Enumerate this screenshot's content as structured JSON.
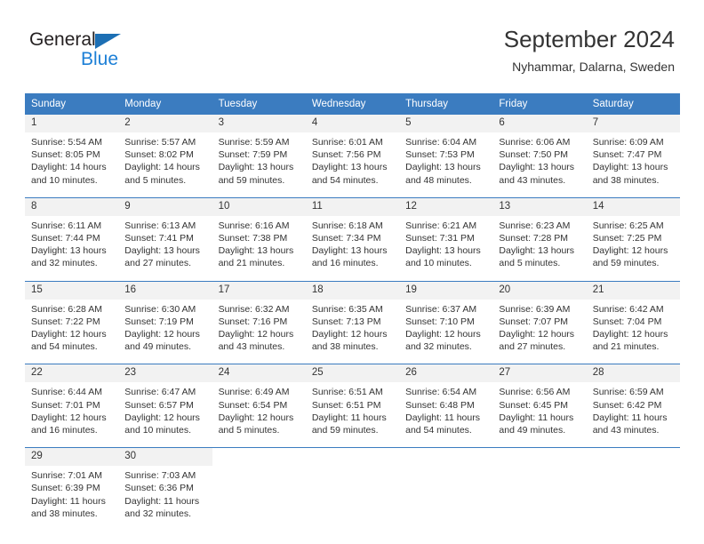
{
  "brand": {
    "name_part1": "General",
    "name_part2": "Blue",
    "triangle_icon": "blue-triangle-icon"
  },
  "header": {
    "title": "September 2024",
    "subtitle": "Nyhammar, Dalarna, Sweden"
  },
  "colors": {
    "header_blue": "#3b7cc0",
    "day_number_bg": "#f2f2f2",
    "brand_blue": "#1c7fd6",
    "text": "#333333"
  },
  "weekdays": [
    "Sunday",
    "Monday",
    "Tuesday",
    "Wednesday",
    "Thursday",
    "Friday",
    "Saturday"
  ],
  "labels": {
    "sunrise_prefix": "Sunrise:",
    "sunset_prefix": "Sunset:",
    "daylight_prefix": "Daylight:"
  },
  "weeks": [
    [
      {
        "day": "1",
        "sunrise": "Sunrise: 5:54 AM",
        "sunset": "Sunset: 8:05 PM",
        "daylight": "Daylight: 14 hours and 10 minutes."
      },
      {
        "day": "2",
        "sunrise": "Sunrise: 5:57 AM",
        "sunset": "Sunset: 8:02 PM",
        "daylight": "Daylight: 14 hours and 5 minutes."
      },
      {
        "day": "3",
        "sunrise": "Sunrise: 5:59 AM",
        "sunset": "Sunset: 7:59 PM",
        "daylight": "Daylight: 13 hours and 59 minutes."
      },
      {
        "day": "4",
        "sunrise": "Sunrise: 6:01 AM",
        "sunset": "Sunset: 7:56 PM",
        "daylight": "Daylight: 13 hours and 54 minutes."
      },
      {
        "day": "5",
        "sunrise": "Sunrise: 6:04 AM",
        "sunset": "Sunset: 7:53 PM",
        "daylight": "Daylight: 13 hours and 48 minutes."
      },
      {
        "day": "6",
        "sunrise": "Sunrise: 6:06 AM",
        "sunset": "Sunset: 7:50 PM",
        "daylight": "Daylight: 13 hours and 43 minutes."
      },
      {
        "day": "7",
        "sunrise": "Sunrise: 6:09 AM",
        "sunset": "Sunset: 7:47 PM",
        "daylight": "Daylight: 13 hours and 38 minutes."
      }
    ],
    [
      {
        "day": "8",
        "sunrise": "Sunrise: 6:11 AM",
        "sunset": "Sunset: 7:44 PM",
        "daylight": "Daylight: 13 hours and 32 minutes."
      },
      {
        "day": "9",
        "sunrise": "Sunrise: 6:13 AM",
        "sunset": "Sunset: 7:41 PM",
        "daylight": "Daylight: 13 hours and 27 minutes."
      },
      {
        "day": "10",
        "sunrise": "Sunrise: 6:16 AM",
        "sunset": "Sunset: 7:38 PM",
        "daylight": "Daylight: 13 hours and 21 minutes."
      },
      {
        "day": "11",
        "sunrise": "Sunrise: 6:18 AM",
        "sunset": "Sunset: 7:34 PM",
        "daylight": "Daylight: 13 hours and 16 minutes."
      },
      {
        "day": "12",
        "sunrise": "Sunrise: 6:21 AM",
        "sunset": "Sunset: 7:31 PM",
        "daylight": "Daylight: 13 hours and 10 minutes."
      },
      {
        "day": "13",
        "sunrise": "Sunrise: 6:23 AM",
        "sunset": "Sunset: 7:28 PM",
        "daylight": "Daylight: 13 hours and 5 minutes."
      },
      {
        "day": "14",
        "sunrise": "Sunrise: 6:25 AM",
        "sunset": "Sunset: 7:25 PM",
        "daylight": "Daylight: 12 hours and 59 minutes."
      }
    ],
    [
      {
        "day": "15",
        "sunrise": "Sunrise: 6:28 AM",
        "sunset": "Sunset: 7:22 PM",
        "daylight": "Daylight: 12 hours and 54 minutes."
      },
      {
        "day": "16",
        "sunrise": "Sunrise: 6:30 AM",
        "sunset": "Sunset: 7:19 PM",
        "daylight": "Daylight: 12 hours and 49 minutes."
      },
      {
        "day": "17",
        "sunrise": "Sunrise: 6:32 AM",
        "sunset": "Sunset: 7:16 PM",
        "daylight": "Daylight: 12 hours and 43 minutes."
      },
      {
        "day": "18",
        "sunrise": "Sunrise: 6:35 AM",
        "sunset": "Sunset: 7:13 PM",
        "daylight": "Daylight: 12 hours and 38 minutes."
      },
      {
        "day": "19",
        "sunrise": "Sunrise: 6:37 AM",
        "sunset": "Sunset: 7:10 PM",
        "daylight": "Daylight: 12 hours and 32 minutes."
      },
      {
        "day": "20",
        "sunrise": "Sunrise: 6:39 AM",
        "sunset": "Sunset: 7:07 PM",
        "daylight": "Daylight: 12 hours and 27 minutes."
      },
      {
        "day": "21",
        "sunrise": "Sunrise: 6:42 AM",
        "sunset": "Sunset: 7:04 PM",
        "daylight": "Daylight: 12 hours and 21 minutes."
      }
    ],
    [
      {
        "day": "22",
        "sunrise": "Sunrise: 6:44 AM",
        "sunset": "Sunset: 7:01 PM",
        "daylight": "Daylight: 12 hours and 16 minutes."
      },
      {
        "day": "23",
        "sunrise": "Sunrise: 6:47 AM",
        "sunset": "Sunset: 6:57 PM",
        "daylight": "Daylight: 12 hours and 10 minutes."
      },
      {
        "day": "24",
        "sunrise": "Sunrise: 6:49 AM",
        "sunset": "Sunset: 6:54 PM",
        "daylight": "Daylight: 12 hours and 5 minutes."
      },
      {
        "day": "25",
        "sunrise": "Sunrise: 6:51 AM",
        "sunset": "Sunset: 6:51 PM",
        "daylight": "Daylight: 11 hours and 59 minutes."
      },
      {
        "day": "26",
        "sunrise": "Sunrise: 6:54 AM",
        "sunset": "Sunset: 6:48 PM",
        "daylight": "Daylight: 11 hours and 54 minutes."
      },
      {
        "day": "27",
        "sunrise": "Sunrise: 6:56 AM",
        "sunset": "Sunset: 6:45 PM",
        "daylight": "Daylight: 11 hours and 49 minutes."
      },
      {
        "day": "28",
        "sunrise": "Sunrise: 6:59 AM",
        "sunset": "Sunset: 6:42 PM",
        "daylight": "Daylight: 11 hours and 43 minutes."
      }
    ],
    [
      {
        "day": "29",
        "sunrise": "Sunrise: 7:01 AM",
        "sunset": "Sunset: 6:39 PM",
        "daylight": "Daylight: 11 hours and 38 minutes."
      },
      {
        "day": "30",
        "sunrise": "Sunrise: 7:03 AM",
        "sunset": "Sunset: 6:36 PM",
        "daylight": "Daylight: 11 hours and 32 minutes."
      },
      {
        "day": "",
        "sunrise": "",
        "sunset": "",
        "daylight": ""
      },
      {
        "day": "",
        "sunrise": "",
        "sunset": "",
        "daylight": ""
      },
      {
        "day": "",
        "sunrise": "",
        "sunset": "",
        "daylight": ""
      },
      {
        "day": "",
        "sunrise": "",
        "sunset": "",
        "daylight": ""
      },
      {
        "day": "",
        "sunrise": "",
        "sunset": "",
        "daylight": ""
      }
    ]
  ]
}
